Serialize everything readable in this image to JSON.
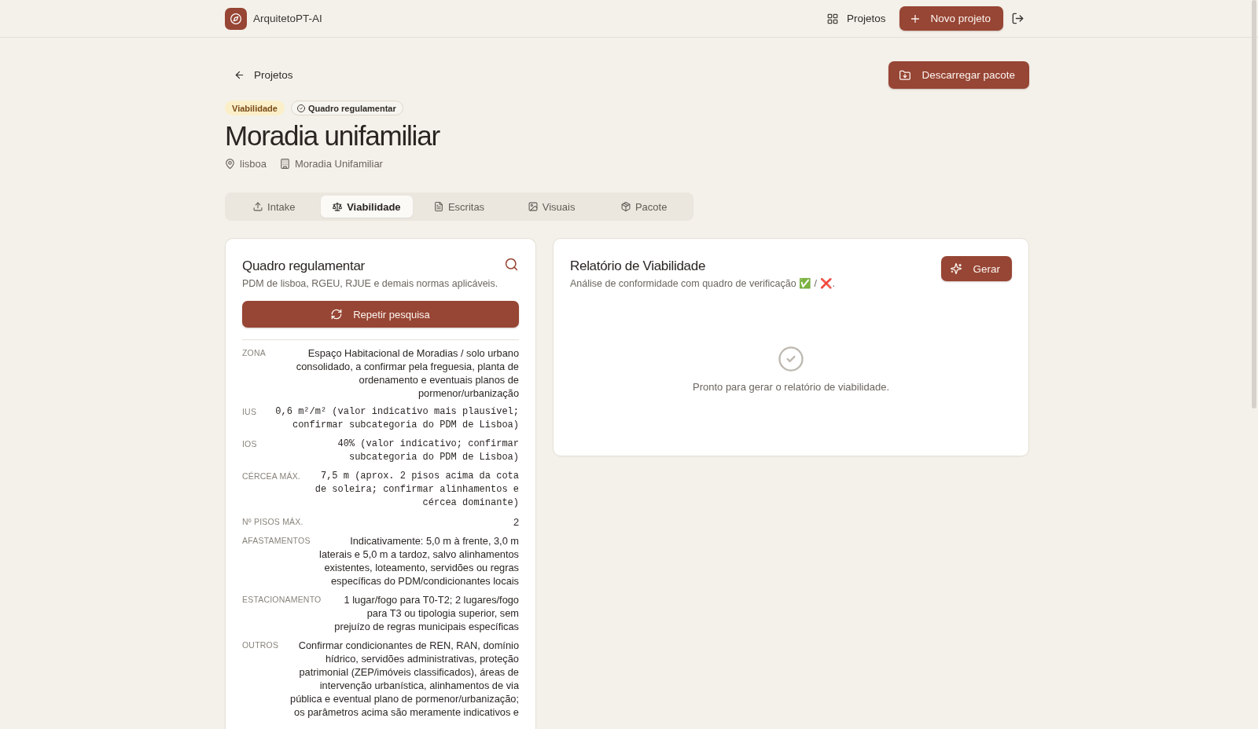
{
  "header": {
    "brand": "ArquitetoPT-AI",
    "nav_link": "Projetos",
    "new_button": "Novo projeto"
  },
  "back_link": "Projetos",
  "download_button": "Descarregar pacote",
  "project": {
    "badges": [
      {
        "label": "Viabilidade",
        "kind": "phase"
      },
      {
        "label": "Quadro regulamentar",
        "kind": "status"
      }
    ],
    "title": "Moradia unifamiliar",
    "meta": [
      {
        "kind": "location",
        "text": "lisboa"
      },
      {
        "kind": "building",
        "text": "Moradia Unifamiliar"
      }
    ]
  },
  "tabs": [
    {
      "label": "Intake",
      "selected": false
    },
    {
      "label": "Viabilidade",
      "selected": true
    },
    {
      "label": "Escritas",
      "selected": false
    },
    {
      "label": "Visuais",
      "selected": false
    },
    {
      "label": "Pacote",
      "selected": false
    }
  ],
  "regulations": {
    "title": "Quadro regulamentar",
    "subtitle": "PDM de lisboa, RGEU, RJUE e demais normas aplicáveis.",
    "button": "Repetir pesquisa",
    "rows": [
      {
        "label": "ZONA",
        "value": "Espaço Habitacional de Moradias / solo urbano consolidado, a confirmar pela freguesia, planta de ordenamento e eventuais planos de pormenor/urbanização",
        "kind": "text"
      },
      {
        "label": "IUS",
        "value": "0,6 m²/m² (valor indicativo mais plausível; confirmar subcategoria do PDM de Lisboa)",
        "kind": "code"
      },
      {
        "label": "IOS",
        "value": "40% (valor indicativo; confirmar subcategoria do PDM de Lisboa)",
        "kind": "code"
      },
      {
        "label": "CÉRCEA MÁX.",
        "value": "7,5 m (aprox. 2 pisos acima da cota de soleira; confirmar alinhamentos e cércea dominante)",
        "kind": "code"
      },
      {
        "label": "Nº PISOS MÁX.",
        "value": "2",
        "kind": "text"
      },
      {
        "label": "AFASTAMENTOS",
        "value": "Indicativamente: 5,0 m à frente, 3,0 m laterais e 5,0 m a tardoz, salvo alinhamentos existentes, loteamento, servidões ou regras específicas do PDM/condicionantes locais",
        "kind": "text"
      },
      {
        "label": "ESTACIONAMENTO",
        "value": "1 lugar/fogo para T0-T2; 2 lugares/fogo para T3 ou tipologia superior, sem prejuízo de regras municipais específicas",
        "kind": "text"
      },
      {
        "label": "OUTROS",
        "value": "Confirmar condicionantes de REN, RAN, domínio hídrico, servidões administrativas, proteção patrimonial (ZEP/imóveis classificados), áreas de intervenção urbanística, alinhamentos de via pública e eventual plano de pormenor/urbanização; os parâmetros acima são meramente indicativos e",
        "kind": "text"
      }
    ]
  },
  "report": {
    "title": "Relatório de Viabilidade",
    "subtitle": "Análise de conformidade com quadro de verificação ✅ / ❌.",
    "button": "Gerar",
    "empty_text": "Pronto para gerar o relatório de viabilidade."
  }
}
